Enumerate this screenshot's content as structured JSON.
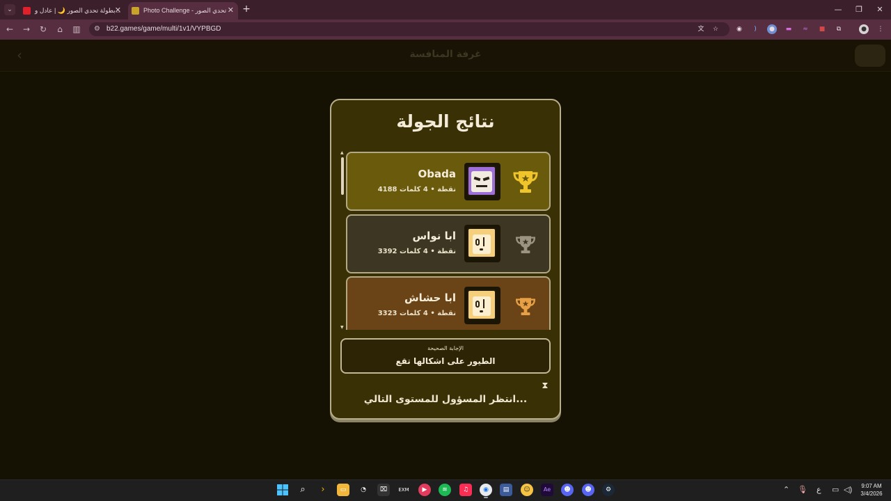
{
  "browser": {
    "tabs": [
      {
        "title": "بطولة تحدي الصور 🌙 | عادل و...",
        "active": false,
        "favicon_color": "#e0202a"
      },
      {
        "title": "Photo Challenge - تحدي الصور",
        "active": true,
        "favicon_color": "#c9a22a"
      }
    ],
    "url": "b22.games/game/multi/1v1/VYPBGD"
  },
  "game_header": {
    "title": "غرفة المنافسة"
  },
  "results": {
    "title": "نتائج الجولة",
    "players": [
      {
        "rank": "gold",
        "name": "Obada",
        "stats": "4188 نقطة • 4 كلمات",
        "avatar_color": "#9e6fd9",
        "trophy_color": "#f0c52c",
        "row_color": "#695a0c"
      },
      {
        "rank": "silver",
        "name": "ابا نواس",
        "stats": "3392 نقطة • 4 كلمات",
        "avatar_color": "#f6cf7d",
        "trophy_color": "#9c9480",
        "row_color": "#3c3622"
      },
      {
        "rank": "bronze",
        "name": "ابا حشاش",
        "stats": "3323 نقطة • 4 كلمات",
        "avatar_color": "#f6cf7d",
        "trophy_color": "#e7a045",
        "row_color": "#6a4316"
      }
    ],
    "correct_answer_label": "الإجابة الصحيحة",
    "correct_answer": "الطيور على اشكالها تقع",
    "waiting_text": "انتظر المسؤول للمستوى التالي...",
    "hourglass_icon": "hourglass-icon"
  },
  "taskbar": {
    "clock_time": "9:07 AM",
    "clock_date": "3/4/2026",
    "language": "ع"
  }
}
